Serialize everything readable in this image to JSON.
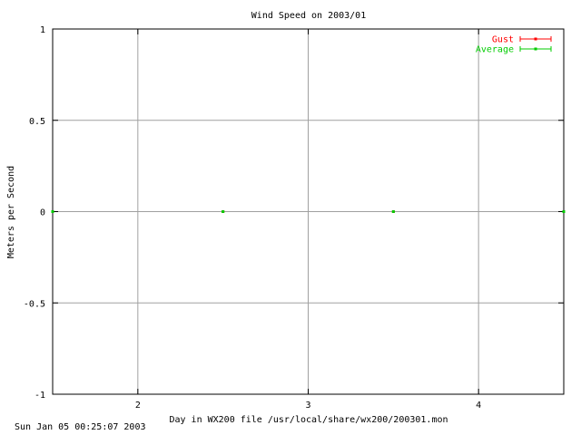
{
  "chart_data": {
    "type": "line",
    "title": "Wind Speed on 2003/01",
    "xlabel": "Day in WX200 file /usr/local/share/wx200/200301.mon",
    "ylabel": "Meters per Second",
    "xlim": [
      1.5,
      4.5
    ],
    "ylim": [
      -1,
      1
    ],
    "xticks": [
      2,
      3,
      4
    ],
    "yticks": [
      -1,
      -0.5,
      0,
      0.5,
      1
    ],
    "ytick_labels": [
      "-1",
      "-0.5",
      "0",
      "0.5",
      "1"
    ],
    "grid": true,
    "legend_position": "top-right",
    "series": [
      {
        "name": "Gust",
        "color": "#ff0000",
        "style": "errorbar-points",
        "x": [
          1.5,
          2.5,
          3.5,
          4.5
        ],
        "values": [
          0,
          0,
          0,
          0
        ]
      },
      {
        "name": "Average",
        "color": "#00cc00",
        "style": "errorbar-points",
        "x": [
          1.5,
          2.5,
          3.5,
          4.5
        ],
        "values": [
          0,
          0,
          0,
          0
        ]
      }
    ]
  },
  "footer": {
    "timestamp": "Sun Jan 05 00:25:07 2003"
  }
}
